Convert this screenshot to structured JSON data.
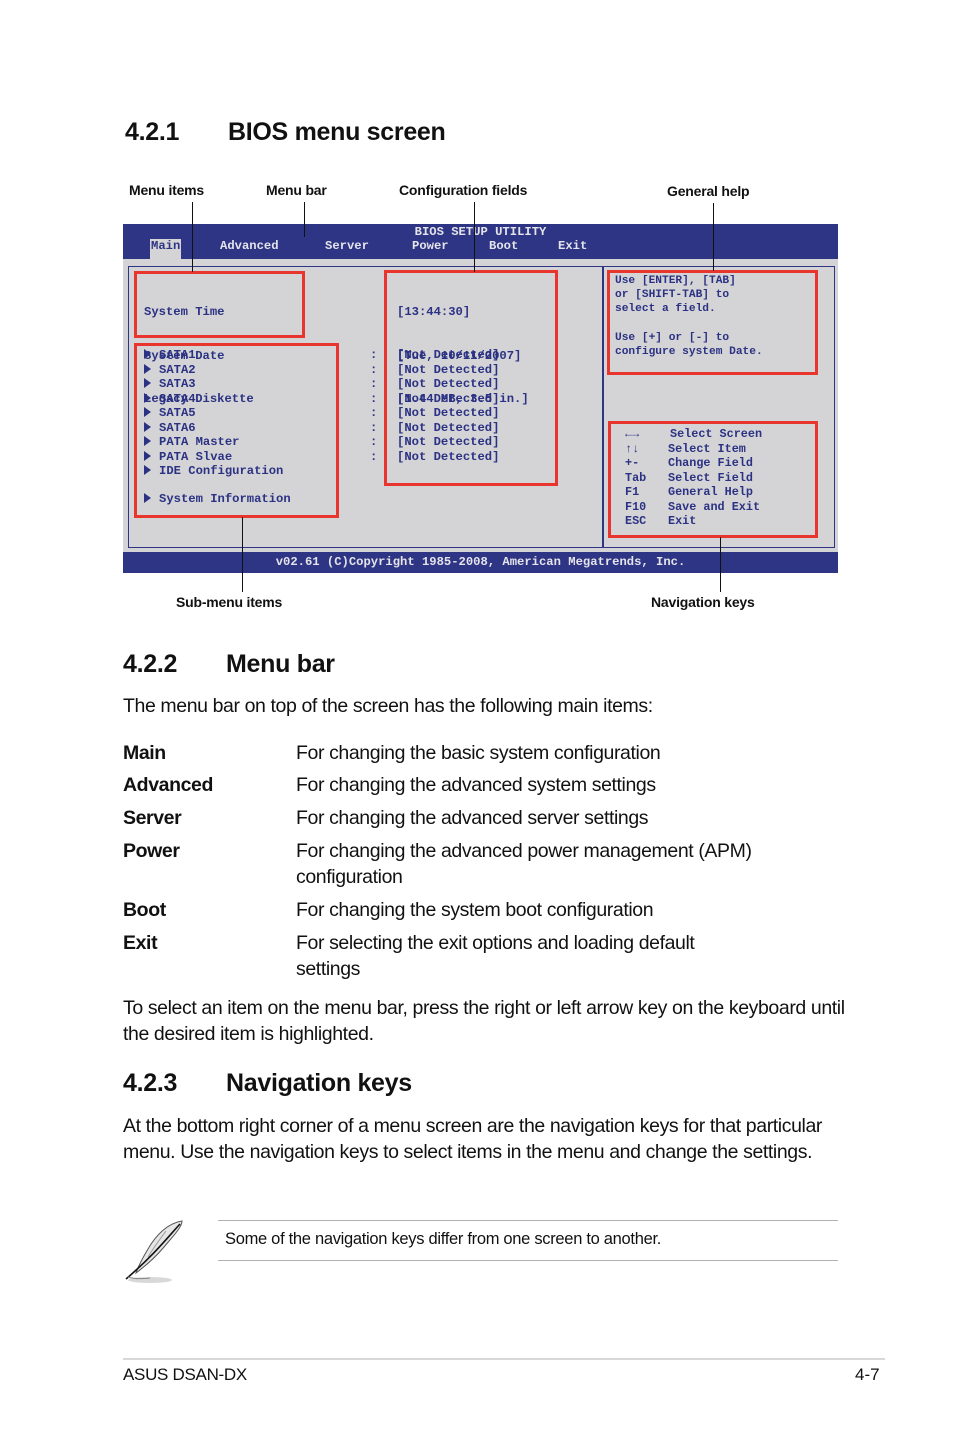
{
  "sections": {
    "s421": {
      "number": "4.2.1",
      "title": "BIOS menu screen"
    },
    "s422": {
      "number": "4.2.2",
      "title": "Menu bar"
    },
    "s423": {
      "number": "4.2.3",
      "title": "Navigation keys"
    }
  },
  "callouts": {
    "menu_items": "Menu items",
    "menu_bar": "Menu bar",
    "config_fields": "Configuration fields",
    "general_help": "General help",
    "sub_menu_items": "Sub-menu items",
    "navigation_keys": "Navigation keys"
  },
  "bios": {
    "title": "BIOS SETUP UTILITY",
    "menu": [
      "Main",
      "Advanced",
      "Server",
      "Power",
      "Boot",
      "Exit"
    ],
    "active_menu": "Main",
    "menu_items": [
      "System Time",
      "System Date",
      "Legacy Diskette"
    ],
    "menu_values": [
      "[13:44:30]",
      "[Tue, 10/11/2007]",
      "[1.44 MB, 3.5 in.]"
    ],
    "submenu_items": [
      {
        "label": "SATA1",
        "sep": ":",
        "value": "[Not Detected]"
      },
      {
        "label": "SATA2",
        "sep": ":",
        "value": "[Not Detected]"
      },
      {
        "label": "SATA3",
        "sep": ":",
        "value": "[Not Detected]"
      },
      {
        "label": "SATA4",
        "sep": ":",
        "value": "[Not Detected]"
      },
      {
        "label": "SATA5",
        "sep": ":",
        "value": "[Not Detected]"
      },
      {
        "label": "SATA6",
        "sep": ":",
        "value": "[Not Detected]"
      },
      {
        "label": "PATA Master",
        "sep": ":",
        "value": "[Not Detected]"
      },
      {
        "label": "PATA Slvae",
        "sep": ":",
        "value": "[Not Detected]"
      },
      {
        "label": "IDE Configuration"
      },
      {
        "label": "System Information"
      }
    ],
    "help_lines": [
      "Use [ENTER], [TAB]",
      "or [SHIFT-TAB] to",
      "select a field.",
      "",
      "Use [+] or [-] to",
      "configure system Date."
    ],
    "nav_keys": [
      {
        "key": "←→",
        "action": "Select Screen"
      },
      {
        "key": "↑↓",
        "action": "Select Item"
      },
      {
        "key": "+-",
        "action": "Change Field"
      },
      {
        "key": "Tab",
        "action": "Select Field"
      },
      {
        "key": "F1",
        "action": "General Help"
      },
      {
        "key": "F10",
        "action": "Save and Exit"
      },
      {
        "key": "ESC",
        "action": "Exit"
      }
    ],
    "copyright": "v02.61 (C)Copyright 1985-2008, American Megatrends, Inc."
  },
  "menu_bar_section": {
    "intro": "The menu bar on top of the screen has the following main items:",
    "items": [
      {
        "term": "Main",
        "desc": "For changing the basic system configuration"
      },
      {
        "term": "Advanced",
        "desc": "For changing the advanced system settings"
      },
      {
        "term": "Server",
        "desc": "For changing the advanced server settings"
      },
      {
        "term": "Power",
        "desc": "For changing the advanced power management (APM) configuration"
      },
      {
        "term": "Boot",
        "desc": "For changing the system boot configuration"
      },
      {
        "term": "Exit",
        "desc": "For selecting the exit options and loading default settings"
      }
    ],
    "outro": "To select an item on the menu bar, press the right or left arrow key on the keyboard until the desired item is highlighted."
  },
  "nav_section": {
    "body": "At the bottom right corner of a menu screen are the navigation keys for that particular menu. Use the navigation keys to select items in the menu and change the settings."
  },
  "note": {
    "icon": "feather-pen-icon",
    "text": "Some of the navigation keys differ from one screen to another."
  },
  "footer": {
    "product": "ASUS DSAN-DX",
    "page": "4-7"
  },
  "colors": {
    "bios_blue": "#2e3584",
    "bios_gray": "#d4d4d6",
    "highlight_red": "#e8352d"
  }
}
